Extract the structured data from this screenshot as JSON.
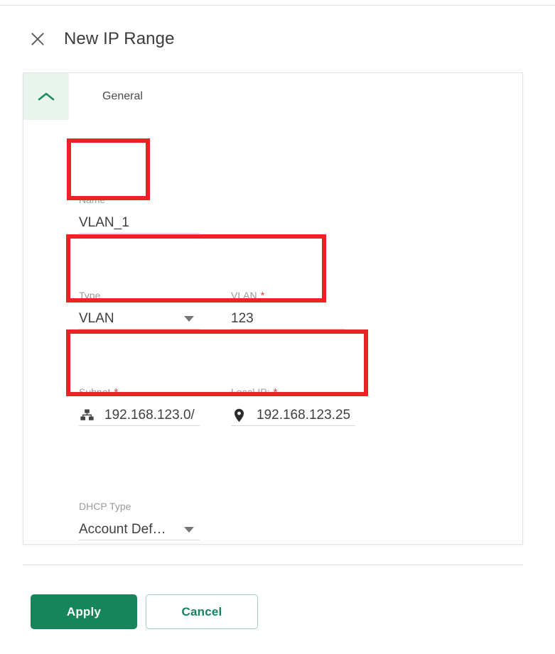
{
  "dialog": {
    "title": "New IP Range",
    "close_icon": "close-icon"
  },
  "section": {
    "title": "General",
    "collapse_icon": "chevron-up-icon",
    "expanded": true
  },
  "fields": {
    "name": {
      "label": "Name",
      "required_marker": "*",
      "value": "VLAN_1"
    },
    "type": {
      "label": "Type",
      "required_marker": "",
      "value": "VLAN",
      "icon": "chevron-down-icon",
      "options": [
        "VLAN"
      ]
    },
    "vlan": {
      "label": "VLAN",
      "required_marker": "*",
      "value": "123"
    },
    "subnet": {
      "label": "Subnet",
      "required_marker": "*",
      "value": "192.168.123.0/",
      "icon": "network-sitemap-icon"
    },
    "local_ip": {
      "label": "Local IP:",
      "required_marker": "*",
      "value": "192.168.123.25",
      "icon": "map-pin-icon"
    },
    "dhcp_type": {
      "label": "DHCP Type",
      "required_marker": "",
      "value": "Account Def…",
      "icon": "chevron-down-icon",
      "options": [
        "Account Def…"
      ]
    }
  },
  "footer": {
    "apply_label": "Apply",
    "cancel_label": "Cancel"
  },
  "colors": {
    "accent_green": "#16855c",
    "section_head_bg": "#eaf4ef",
    "annotation_red": "#ec2227",
    "required_red": "#e8453c",
    "label_gray": "#9b9b9b",
    "value_gray": "#3f3f3f"
  },
  "annotations": [
    {
      "name": "name-field-highlight"
    },
    {
      "name": "type-vlan-row-highlight"
    },
    {
      "name": "subnet-localip-row-highlight"
    }
  ]
}
